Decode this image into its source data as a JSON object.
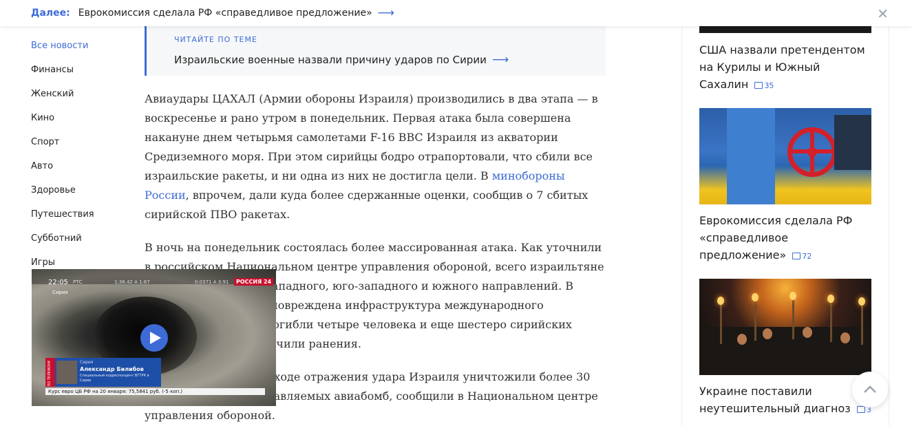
{
  "topbar": {
    "next_label": "Далее:",
    "next_title": "Еврокомиссия сделала РФ «справедливое предложение»",
    "arrow": "⟶",
    "close": "✕"
  },
  "nav": {
    "items": [
      "Все новости",
      "Финансы",
      "Женский",
      "Кино",
      "Спорт",
      "Авто",
      "Здоровье",
      "Путешествия",
      "Субботний",
      "Игры"
    ]
  },
  "related": {
    "kicker": "ЧИТАЙТЕ ПО ТЕМЕ",
    "title": "Израильские военные назвали причину ударов по Сирии",
    "arrow": "⟶"
  },
  "article": {
    "p1_a": "Авиаудары ЦАХАЛ (Армии обороны Израиля) производились в два этапа — в воскресенье и рано утром в понедельник. Первая атака была совершена накануне днем четырьмя самолетами F-16 ВВС Израиля из акватории Средиземного моря. При этом сирийцы бодро отрапортовали, что сбили все израильские ракеты, и ни одна из них не достигла цели. В ",
    "p1_link": "минобороны России",
    "p1_b": ", впрочем, дали куда более сдержанные оценки, сообщив о 7 сбитых сирийской ПВО ракетах.",
    "p2": "В ночь на понедельник состоялась более массированная атака. Как уточнили в российском Национальном центре управления обороной, всего израильтяне выпустили ракеты с западного, юго-западного и южного направлений. В результате частично повреждена инфраструктура международного аэропорта Дамаска, погибли четыре человека и еще шестеро сирийских военнослужащих получили ранения.",
    "p3": "Силами ПВО Сирии в ходе отражения удара Израиля уничтожили более 30 крылатых ракет и управляемых авиабомб, сообщили в Национальном центре управления обороной."
  },
  "video": {
    "time": "22:05",
    "channel_small": "РТС",
    "place": "Сирия",
    "coords1": "1:36.42 А 1:67",
    "coords2": "0.0371 А 3:91",
    "logo": "РОССИЯ 24",
    "side_label": "ПО ТЕЛЕФОНУ",
    "caption_location": "Сирия",
    "caption_name": "Александр Билибов",
    "caption_role": "Специальный корреспондент ВГТРК в Сирии",
    "ticker": "Курс евро ЦБ РФ на 20 января: 75,5841 руб. (-5 коп.)"
  },
  "sidebar": {
    "items": [
      {
        "title": "США назвали претендентом на Курилы и Южный Сахалин",
        "comments": "35"
      },
      {
        "title": "Еврокомиссия сделала РФ «справедливое предложение»",
        "comments": "72"
      },
      {
        "title": "Украине поставили неутешительный диагноз",
        "comments": "3"
      }
    ]
  },
  "colors": {
    "accent": "#3d6bd6",
    "text": "#222222",
    "related_bg": "#f6f7f9"
  }
}
